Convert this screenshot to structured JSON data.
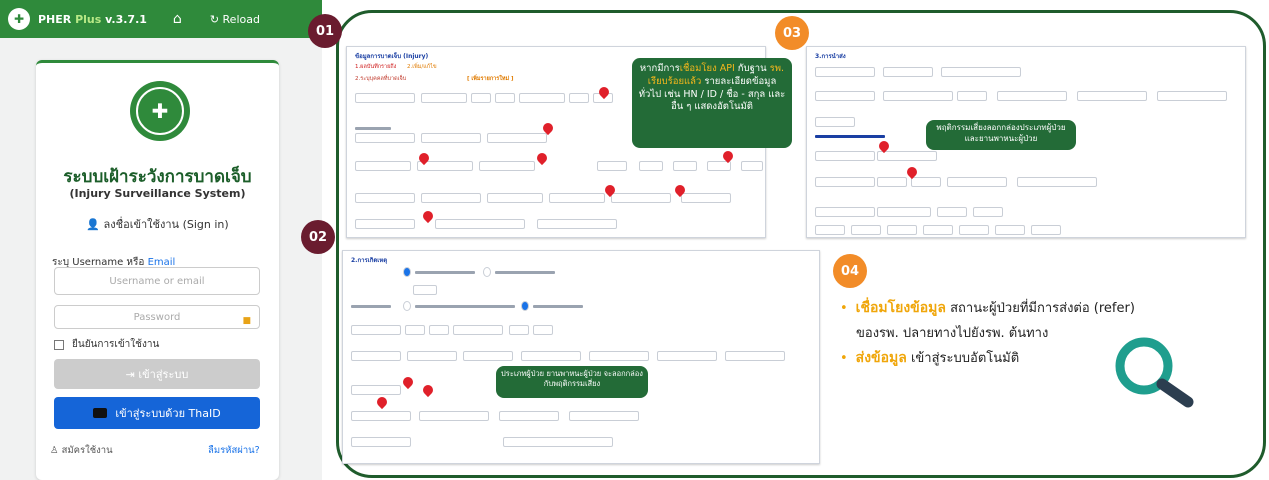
{
  "topbar": {
    "brand_prefix": "PHER ",
    "brand_plus": "Plus",
    "brand_version": " v.3.7.1",
    "home_icon": "home-icon",
    "reload_label": "Reload"
  },
  "login": {
    "system_name_th": "ระบบเฝ้าระวังการบาดเจ็บ",
    "system_name_en": "(Injury Surveillance System)",
    "signin_prefix": "ลงชื่อเข้าใช้งาน ",
    "signin_en": "(Sign in)",
    "username_label": "ระบุ Username หรือ ",
    "username_label_email": "Email",
    "username_placeholder": "Username or email",
    "password_placeholder": "Password",
    "remember_label": "ยืนยันการเข้าใช้งาน",
    "login_button": "เข้าสู่ระบบ",
    "thaid_button": "เข้าสู่ระบบด้วย ThaID",
    "register_link": "สมัครใช้งาน",
    "forgot_link": "ลืมรหัสผ่าน?"
  },
  "badges": {
    "b01": "01",
    "b02": "02",
    "b03": "03",
    "b04": "04"
  },
  "callouts": {
    "c03_a": "หากมีการ",
    "c03_b": "เชื่อมโยง API",
    "c03_c": " กับฐาน",
    "c03_d": "รพ. เรียบร้อยแล้ว",
    "c03_e": " รายละเอียดข้อมูลทั่วไป เช่น HN / ID / ชื่อ - สกุล และอื่น ๆ แสดงอัตโนมัติ",
    "c_right": "พฤติกรรมเสี่ยงลอกกล่องประเภทผู้ป่วย และยานพาหนะผู้ป่วย",
    "c02": "ประเภทผู้ป่วย ยานพาหนะผู้ป่วย จะลอกกล่องกับพฤติกรรมเสี่ยง"
  },
  "form01": {
    "title": "ข้อมูลการบาดเจ็บ (Injury)",
    "tab1": "1.ผลบันทึกรายถึง",
    "tab2": "2.เพิ่ม/แก้ไข",
    "section": "2.ระบุบุคคลที่บาดเจ็บ",
    "add_new": "[ เพิ่มรายการใหม่ ]"
  },
  "form02": {
    "title": "2.การเกิดเหตุ"
  },
  "form03": {
    "title": "3.การนำส่ง"
  },
  "summary": {
    "line1_bold": "เชื่อมโยงข้อมูล",
    "line1_rest": " สถานะผู้ป่วยที่มีการส่งต่อ (refer)",
    "line2": "ของรพ. ปลายทางไปยังรพ. ต้นทาง",
    "line3_bold": "ส่งข้อมูล",
    "line3_rest": " เข้าสู่ระบบอัตโนมัติ",
    "search_icon": "magnifier-icon"
  }
}
